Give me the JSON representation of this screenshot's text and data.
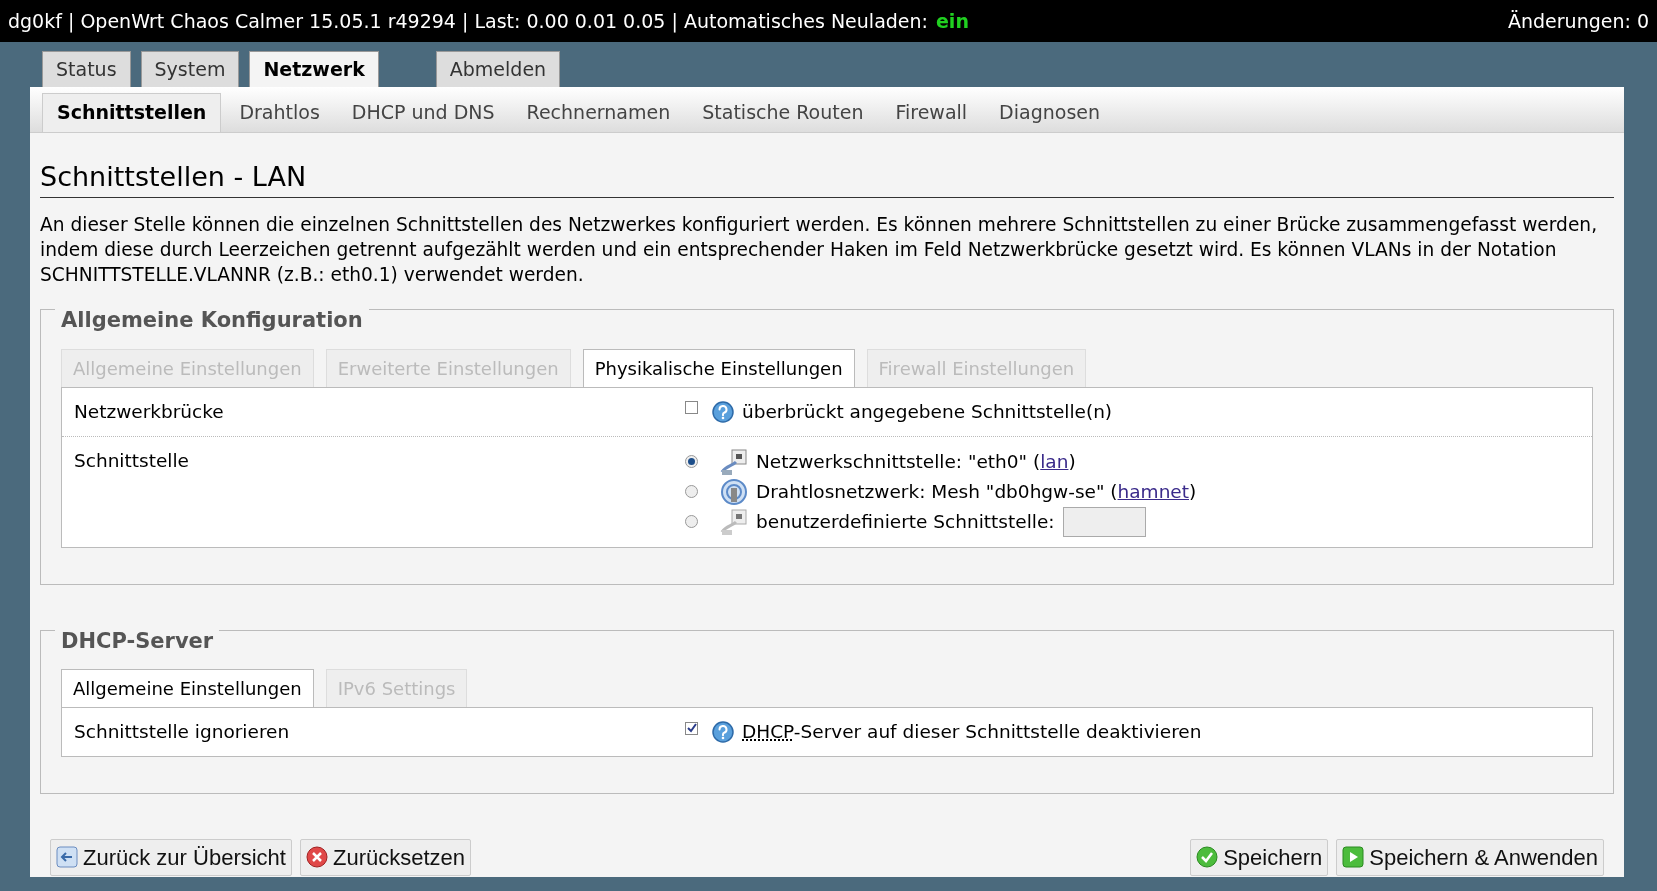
{
  "header": {
    "info": "dg0kf | OpenWrt Chaos Calmer 15.05.1 r49294 | Last: 0.00 0.01 0.05 | Automatisches Neuladen:",
    "autoreload": "ein",
    "autoreload_on": true,
    "changes": "Änderungen: 0"
  },
  "main_tabs": [
    {
      "label": "Status",
      "selected": false,
      "kind": "menu"
    },
    {
      "label": "System",
      "selected": false,
      "kind": "menu"
    },
    {
      "label": "Netzwerk",
      "selected": true,
      "kind": "menu"
    },
    {
      "label": "Abmelden",
      "selected": false,
      "kind": "logout"
    }
  ],
  "sub_tabs": [
    {
      "label": "Schnittstellen",
      "selected": true
    },
    {
      "label": "Drahtlos",
      "selected": false
    },
    {
      "label": "DHCP und DNS",
      "selected": false
    },
    {
      "label": "Rechnernamen",
      "selected": false
    },
    {
      "label": "Statische Routen",
      "selected": false
    },
    {
      "label": "Firewall",
      "selected": false
    },
    {
      "label": "Diagnosen",
      "selected": false
    }
  ],
  "page": {
    "title": "Schnittstellen - LAN",
    "description": "An dieser Stelle können die einzelnen Schnittstellen des Netzwerkes konfiguriert werden. Es können mehrere Schnittstellen zu einer Brücke zusammengefasst werden, indem diese durch Leerzeichen getrennt aufgezählt werden und ein entsprechender Haken im Feld Netzwerkbrücke gesetzt wird. Es können VLANs in der Notation SCHNITTSTELLE.VLANNR (z.B.: eth0.1) verwendet werden."
  },
  "sections": [
    {
      "title": "Allgemeine Konfiguration",
      "tabs": [
        {
          "label": "Allgemeine Einstellungen",
          "selected": false
        },
        {
          "label": "Erweiterte Einstellungen",
          "selected": false
        },
        {
          "label": "Physikalische Einstellungen",
          "selected": true
        },
        {
          "label": "Firewall Einstellungen",
          "selected": false
        }
      ],
      "rows": [
        {
          "kind": "checkbox",
          "label": "Netzwerkbrücke",
          "checked": false,
          "text": "überbrückt angegebene Schnittstelle(n)"
        },
        {
          "kind": "radio",
          "label": "Schnittstelle",
          "options": [
            {
              "kind": "wired",
              "selected": true,
              "text": "Netzwerkschnittstelle: \"eth0\" (",
              "link": "lan",
              "suffix": ")"
            },
            {
              "kind": "wireless",
              "selected": false,
              "text": "Drahtlosnetzwerk: Mesh \"db0hgw-se\" (",
              "link": "hamnet",
              "suffix": ")"
            },
            {
              "kind": "custom",
              "selected": false,
              "text": "benutzerdefinierte Schnittstelle:"
            }
          ]
        }
      ]
    },
    {
      "title": "DHCP-Server",
      "tabs": [
        {
          "label": "Allgemeine Einstellungen",
          "selected": true
        },
        {
          "label": "IPv6 Settings",
          "selected": false
        }
      ],
      "rows": [
        {
          "kind": "checkbox",
          "label": "Schnittstelle ignorieren",
          "checked": true,
          "abbr": "DHCP",
          "text": "-Server auf dieser Schnittstelle deaktivieren"
        }
      ]
    }
  ],
  "footer": {
    "left": [
      {
        "label": "Zurück zur Übersicht",
        "kind": "back"
      },
      {
        "label": "Zurücksetzen",
        "kind": "reset"
      }
    ],
    "right": [
      {
        "label": "Speichern",
        "kind": "save"
      },
      {
        "label": "Speichern & Anwenden",
        "kind": "apply"
      }
    ]
  }
}
